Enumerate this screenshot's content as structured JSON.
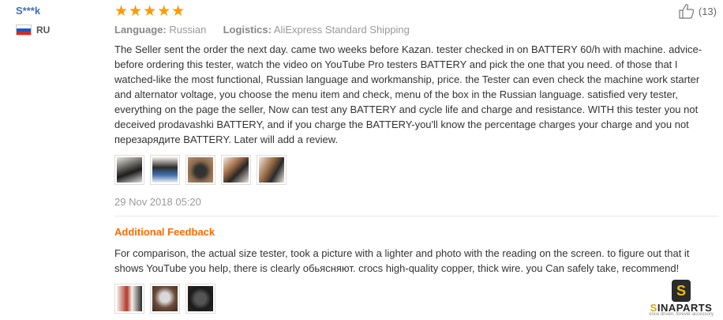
{
  "user": {
    "name": "S***k",
    "country": "RU"
  },
  "review": {
    "rating_stars": "★★★★★",
    "language_label": "Language:",
    "language": "Russian",
    "logistics_label": "Logistics:",
    "logistics": "AliExpress Standard Shipping",
    "text": "The Seller sent the order the next day. came two weeks before Kazan. tester checked in on BATTERY 60/h with machine. advice-before ordering this tester, watch the video on YouTube Pro testers BATTERY and pick the one that you need. of those that I watched-like the most functional, Russian language and workmanship, price. the Tester can even check the machine work starter and alternator voltage, you choose the menu item and check, menu of the box in the Russian language. satisfied very tester, everything on the page the seller, Now can test any BATTERY and cycle life and charge and resistance. WITH this tester you not deceived prodavashki BATTERY, and if you charge the BATTERY-you'll know the percentage charges your charge and you not перезарядите BATTERY. Later will add a review.",
    "date": "29 Nov 2018 05:20",
    "helpful_count": "(13)"
  },
  "additional": {
    "title": "Additional Feedback",
    "text": "For comparison, the actual size tester, took a picture with a lighter and photo with the reading on the screen. to figure out that it shows YouTube you help, there is clearly обьясняют. crocs high-quality copper, thick wire. you Can safely take, recommend!"
  },
  "logo": {
    "text_a": "S",
    "text_b": "INAPARTS",
    "tagline": "once driven. forever accessory",
    "mark": "S"
  },
  "colors": {
    "star": "#ff9a00",
    "link": "#3b6fb6",
    "accent": "#ff6a00"
  }
}
